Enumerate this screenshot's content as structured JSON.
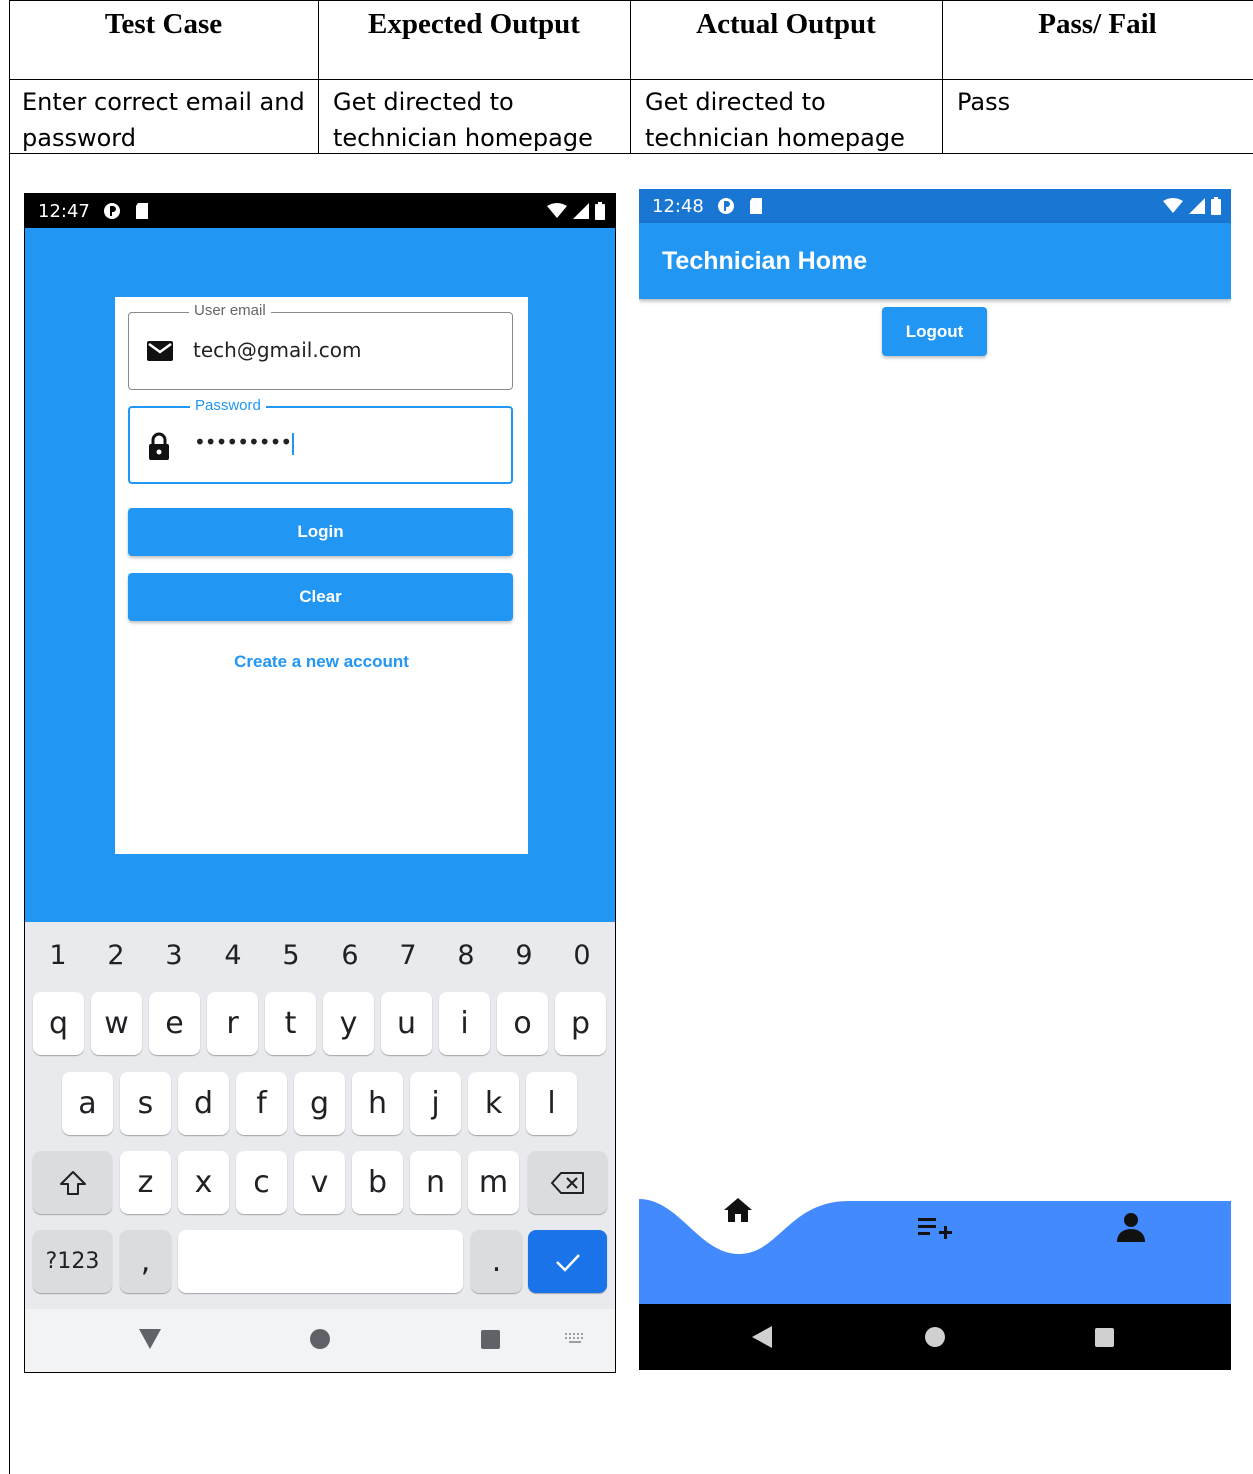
{
  "table": {
    "headers": [
      "Test Case",
      "Expected Output",
      "Actual Output",
      "Pass/ Fail"
    ],
    "row": {
      "test_case": [
        "Enter correct email and",
        "password"
      ],
      "expected": [
        "Get directed to",
        "technician homepage"
      ],
      "actual": [
        "Get directed to",
        "technician homepage"
      ],
      "result": "Pass"
    }
  },
  "login_screen": {
    "status_time": "12:47",
    "email_label": "User email",
    "email_value": "tech@gmail.com",
    "password_label": "Password",
    "password_value": "•••••••••",
    "login_label": "Login",
    "clear_label": "Clear",
    "create_account_label": "Create a new account",
    "keyboard": {
      "numbers": [
        "1",
        "2",
        "3",
        "4",
        "5",
        "6",
        "7",
        "8",
        "9",
        "0"
      ],
      "row1": [
        "q",
        "w",
        "e",
        "r",
        "t",
        "y",
        "u",
        "i",
        "o",
        "p"
      ],
      "row2": [
        "a",
        "s",
        "d",
        "f",
        "g",
        "h",
        "j",
        "k",
        "l"
      ],
      "row3": [
        "z",
        "x",
        "c",
        "v",
        "b",
        "n",
        "m"
      ],
      "symbols_label": "?123",
      "comma": ",",
      "period": "."
    }
  },
  "home_screen": {
    "status_time": "12:48",
    "title": "Technician Home",
    "logout_label": "Logout"
  },
  "colors": {
    "primary": "#2196f3",
    "status_bar_right": "#1976d2",
    "bottom_nav": "#448aff",
    "keyboard_bg": "#e8eaed",
    "keyboard_action": "#1a73e8"
  }
}
